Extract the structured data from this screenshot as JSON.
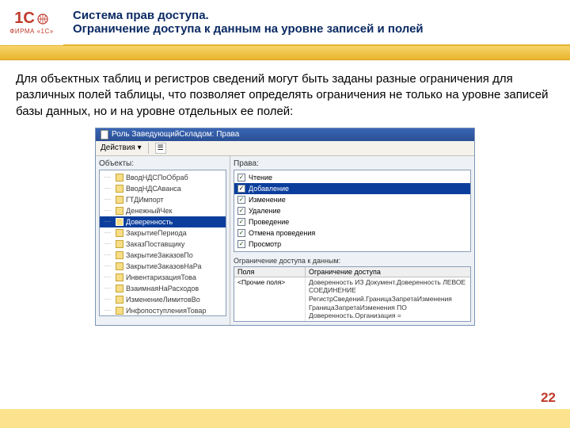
{
  "header": {
    "logo_main": "1С",
    "logo_sub": "ФИРМА «1С»",
    "title_line1": "Система прав доступа.",
    "title_line2": "Ограничение доступа к данным на уровне записей и полей"
  },
  "paragraph": "Для объектных таблиц и регистров сведений могут быть заданы разные ограничения для различных полей таблицы, что позволяет определять ограничения не только на уровне записей базы данных, но и на уровне отдельных ее полей:",
  "app": {
    "window_title": "Роль ЗаведующийСкладом: Права",
    "toolbar": {
      "actions_label": "Действия ▾"
    },
    "left_pane": {
      "title": "Объекты:",
      "items": [
        "ВводНДСПоОбраб",
        "ВводНДСАванса",
        "ГТДИмпорт",
        "ДенежныйЧек",
        "Доверенность",
        "ЗакрытиеПериода",
        "ЗаказПоставщику",
        "ЗакрытиеЗаказовПо",
        "ЗакрытиеЗаказовНаРа",
        "ИнвентаризацияТова",
        "ВзаимнаяНаРасходов",
        "ИзменениеЛимитовВо",
        "ИнфопоступленияТовар"
      ],
      "selected_index": 4
    },
    "right_pane": {
      "title": "Права:",
      "rights": [
        {
          "label": "Чтение",
          "checked": true
        },
        {
          "label": "Добавление",
          "checked": true
        },
        {
          "label": "Изменение",
          "checked": true
        },
        {
          "label": "Удаление",
          "checked": true
        },
        {
          "label": "Проведение",
          "checked": true
        },
        {
          "label": "Отмена проведения",
          "checked": true
        },
        {
          "label": "Просмотр",
          "checked": true
        }
      ],
      "selected_index": 1,
      "restriction_label": "Ограничение доступа к данным:",
      "table": {
        "col1": "Поля",
        "col2": "Ограничение доступа",
        "row_field": "<Прочие поля>",
        "row_text": "Доверенность ИЗ Документ.Доверенность ЛЕВОЕ СОЕДИНЕНИЕ\nРегистрСведений.ГраницаЗапретаИзменения\nГраницаЗапретаИзменения ПО\nДоверенность.Организация ="
      }
    }
  },
  "page_number": "22"
}
